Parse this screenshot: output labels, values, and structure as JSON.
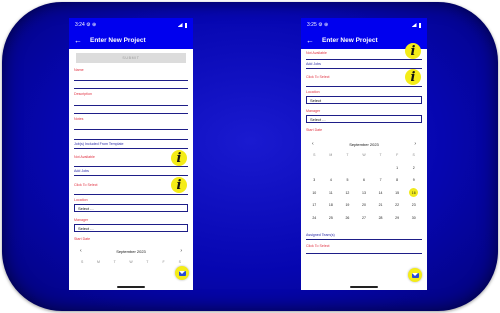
{
  "left": {
    "status": {
      "time": "3:24",
      "icons": "⚙ ⊕"
    },
    "app_title": "Enter New Project",
    "submit_label": "SUBMIT",
    "fields": {
      "name": "Name",
      "description": "Description",
      "notes": "Notes",
      "jobs_template": "Job(s) Included From Template",
      "not_available": "Not Available",
      "add_jobs": "Add Jobs",
      "click_to_select": "Click To Select",
      "location": "Location",
      "manager": "Manager",
      "start_date": "Start Date"
    },
    "location_value": "Select ...",
    "manager_value": "Select ...",
    "calendar": {
      "month": "September 2023",
      "prev": "‹",
      "next": "›",
      "weekdays": [
        "S",
        "M",
        "T",
        "W",
        "T",
        "F",
        "S"
      ]
    }
  },
  "right": {
    "status": {
      "time": "3:25",
      "icons": "⚙ ⊕"
    },
    "app_title": "Enter New Project",
    "fields": {
      "not_available": "Not Available",
      "add_jobs": "Add Jobs",
      "click_to_select": "Click To Select",
      "location": "Location",
      "manager": "Manager",
      "start_date": "Start Date",
      "assigned_teams": "Assigned Team(s)",
      "click_to_select_2": "Click To Select"
    },
    "location_value": "Select",
    "manager_value": "Select ...",
    "calendar": {
      "month": "September 2023",
      "prev": "‹",
      "next": "›",
      "weekdays": [
        "S",
        "M",
        "T",
        "W",
        "T",
        "F",
        "S"
      ],
      "weeks": [
        [
          "",
          "",
          "",
          "",
          "",
          "1",
          "2"
        ],
        [
          "3",
          "4",
          "5",
          "6",
          "7",
          "8",
          "9"
        ],
        [
          "10",
          "11",
          "12",
          "13",
          "14",
          "15",
          "16"
        ],
        [
          "17",
          "18",
          "19",
          "20",
          "21",
          "22",
          "23"
        ],
        [
          "24",
          "25",
          "26",
          "27",
          "28",
          "29",
          "30"
        ]
      ],
      "selected_day": "16"
    }
  },
  "icons": {
    "info": "i",
    "back": "←"
  },
  "colors": {
    "primary": "#0000ee",
    "accent_yellow": "#f4ec18",
    "label_red": "#e03040",
    "background": "#0707b4"
  }
}
